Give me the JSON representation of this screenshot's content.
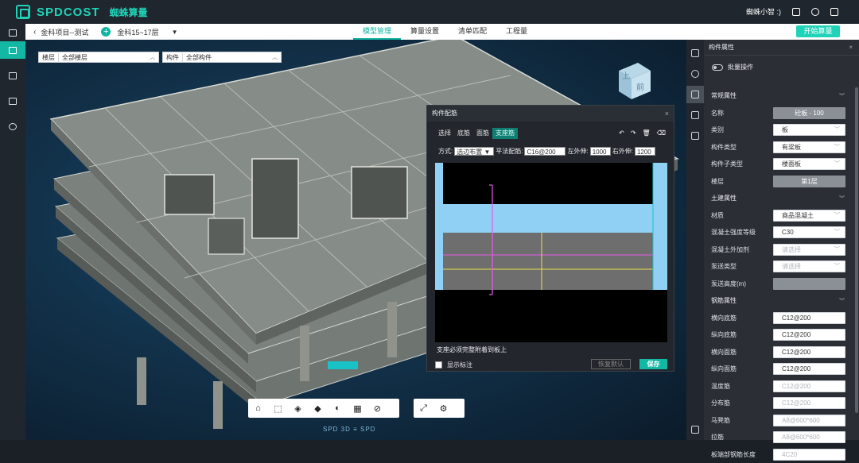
{
  "header": {
    "logo_text": "SPDCOST",
    "app_name": "蜘蛛算量",
    "user": "蜘蛛小智 :)",
    "colors": {
      "accent": "#1fd3b8",
      "topbar": "#1f262e"
    }
  },
  "subbar": {
    "project": "金科项目--测试",
    "floor_range": "金科15~17层",
    "tabs": [
      {
        "label": "模型管理",
        "active": true
      },
      {
        "label": "算量设置",
        "active": false
      },
      {
        "label": "清单匹配",
        "active": false
      },
      {
        "label": "工程量",
        "active": false
      }
    ],
    "start_button": "开始算量"
  },
  "filters": {
    "floor": {
      "label": "楼层",
      "value": "全部楼层"
    },
    "component": {
      "label": "构件",
      "value": "全部构件"
    }
  },
  "view_cube": {
    "top": "上",
    "front": "前"
  },
  "bottom_toolbar": {
    "icons": [
      "home-icon",
      "select-box-icon",
      "cube-icon",
      "solid-cube-icon",
      "sphere-icon",
      "section-icon",
      "hide-icon"
    ],
    "icons2": [
      "fullscreen-icon",
      "settings-icon"
    ]
  },
  "brand_footer": "SPD 3D ≡ SPD",
  "dialog": {
    "title": "构件配筋",
    "tabs": [
      {
        "label": "选择",
        "active": false
      },
      {
        "label": "底筋",
        "active": false
      },
      {
        "label": "面筋",
        "active": false
      },
      {
        "label": "支座筋",
        "active": true
      }
    ],
    "method_label": "方式:",
    "method_value": "选边布置",
    "rebar_label": "平法配筋:",
    "rebar_value": "C16@200",
    "left_label": "左外伸:",
    "left_value": "1000",
    "right_label": "右外伸:",
    "right_value": "1200",
    "note": "支座必须完整附着到板上",
    "show_label": "显示标注",
    "restore_button": "恢复默认",
    "save_button": "保存"
  },
  "panel": {
    "title": "构件属性",
    "batch_label": "批量操作",
    "rows": [
      {
        "type": "section",
        "label": "常规属性"
      },
      {
        "type": "field",
        "label": "名称",
        "value": "砼板 - 100",
        "style": "grey"
      },
      {
        "type": "field",
        "label": "类别",
        "value": "板",
        "dropdown": true
      },
      {
        "type": "field",
        "label": "构件类型",
        "value": "有梁板",
        "dropdown": true
      },
      {
        "type": "field",
        "label": "构件子类型",
        "value": "楼面板",
        "dropdown": true
      },
      {
        "type": "field",
        "label": "楼层",
        "value": "第1层",
        "style": "grey"
      },
      {
        "type": "section",
        "label": "土建属性"
      },
      {
        "type": "field",
        "label": "材质",
        "value": "商品混凝土",
        "dropdown": true
      },
      {
        "type": "field",
        "label": "混凝土强度等级",
        "value": "C30",
        "dropdown": true
      },
      {
        "type": "field",
        "label": "混凝土外加剂",
        "value": "请选择",
        "dropdown": true,
        "placeholder": true
      },
      {
        "type": "field",
        "label": "泵送类型",
        "value": "请选择",
        "dropdown": true,
        "placeholder": true
      },
      {
        "type": "field",
        "label": "泵送高度(m)",
        "value": "",
        "style": "grey"
      },
      {
        "type": "section",
        "label": "钢筋属性"
      },
      {
        "type": "field",
        "label": "横向底筋",
        "value": "C12@200"
      },
      {
        "type": "field",
        "label": "纵向底筋",
        "value": "C12@200"
      },
      {
        "type": "field",
        "label": "横向面筋",
        "value": "C12@200"
      },
      {
        "type": "field",
        "label": "纵向面筋",
        "value": "C12@200"
      },
      {
        "type": "field",
        "label": "温度筋",
        "value": "C12@200",
        "placeholder": true
      },
      {
        "type": "field",
        "label": "分布筋",
        "value": "C12@200",
        "placeholder": true
      },
      {
        "type": "field",
        "label": "马凳筋",
        "value": "A8@600*600",
        "placeholder": true
      },
      {
        "type": "field",
        "label": "拉筋",
        "value": "A8@600*600",
        "placeholder": true
      },
      {
        "type": "field",
        "label": "板端部钢筋长度",
        "value": "4C20",
        "placeholder": true
      }
    ]
  }
}
